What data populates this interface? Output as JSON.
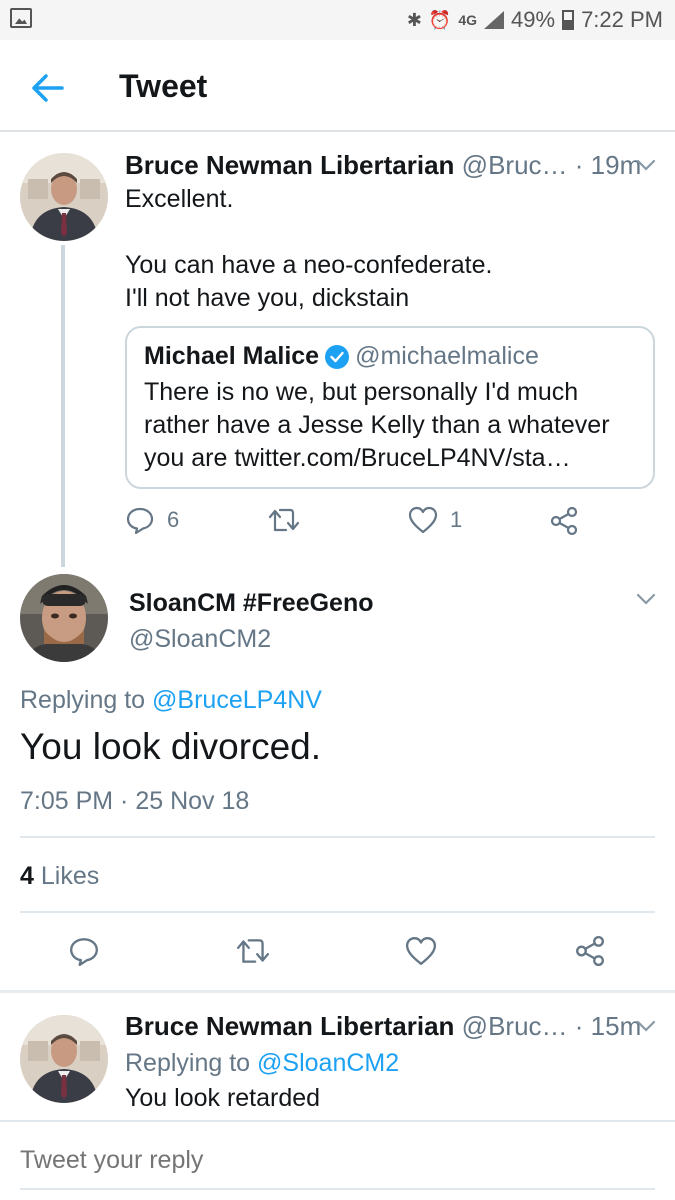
{
  "status_bar": {
    "network": "4G",
    "battery": "49%",
    "time": "7:22 PM"
  },
  "header": {
    "title": "Tweet"
  },
  "tweet1": {
    "name": "Bruce Newman Libertarian",
    "handle": "@Bruc…",
    "time": "· 19m",
    "text": "Excellent.\n\nYou can have a neo-confederate.\nI'll not have you, dickstain",
    "quote": {
      "name": "Michael Malice",
      "handle": "@michaelmalice",
      "text": "There is no we, but personally I'd much rather have a Jesse Kelly than a whatever you are twitter.com/BruceLP4NV/sta…"
    },
    "reply_count": "6",
    "like_count": "1"
  },
  "main_tweet": {
    "name": "SloanCM #FreeGeno",
    "handle": "@SloanCM2",
    "replying_prefix": "Replying to",
    "replying_to": "@BruceLP4NV",
    "text": "You look divorced.",
    "timestamp": "7:05 PM · 25 Nov 18",
    "likes_count": "4",
    "likes_label": "Likes"
  },
  "tweet3": {
    "name": "Bruce Newman Libertarian",
    "handle": "@Bruc…",
    "time": "· 15m",
    "replying_prefix": "Replying to",
    "replying_to": "@SloanCM2",
    "text": "You look retarded"
  },
  "composer": {
    "placeholder": "Tweet your reply"
  },
  "colors": {
    "accent": "#1da1f2",
    "muted": "#657786",
    "divider": "#e1e8ed"
  },
  "icons": [
    "back-arrow-icon",
    "reply-icon",
    "retweet-icon",
    "like-icon",
    "share-icon",
    "chevron-down-icon",
    "verified-badge-icon",
    "gallery-icon",
    "bluetooth-icon",
    "alarm-icon",
    "signal-icon",
    "battery-icon"
  ]
}
